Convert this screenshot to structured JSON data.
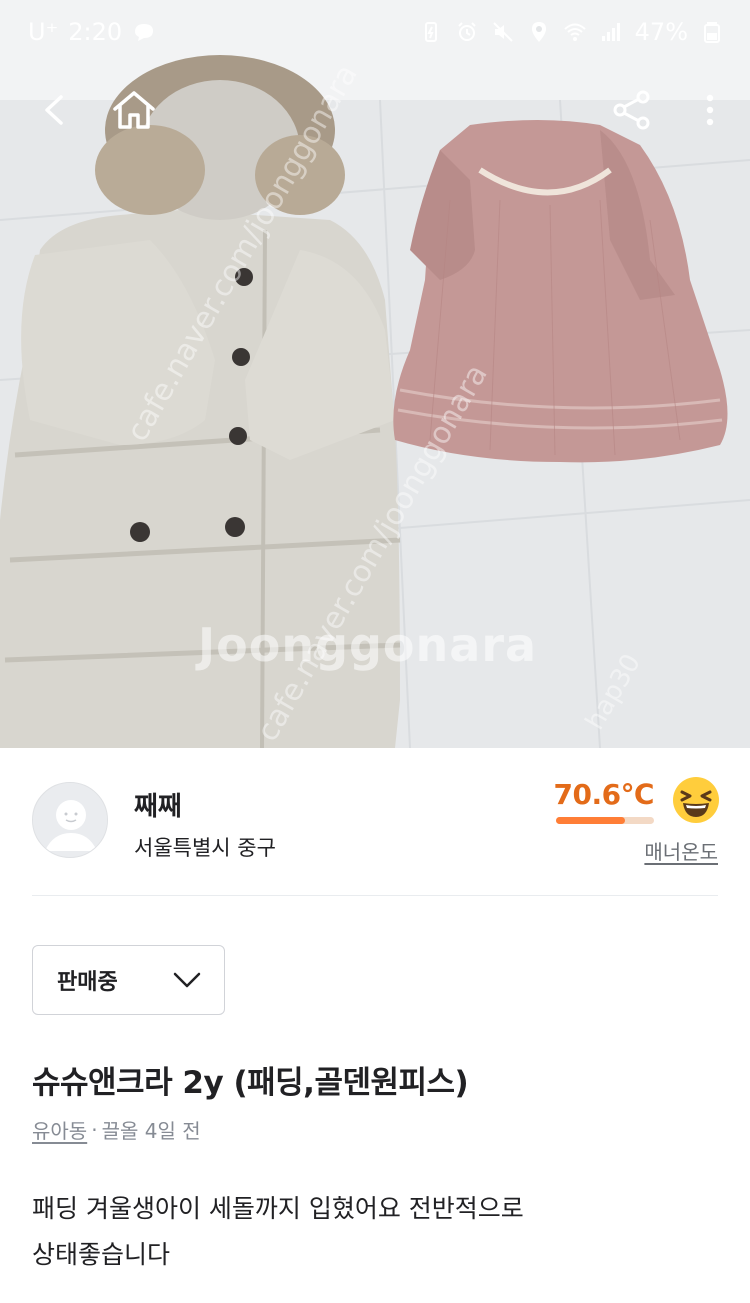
{
  "status_bar": {
    "carrier": "U⁺",
    "time": "2:20",
    "battery": "47%",
    "icons": [
      "chat-bubble-icon",
      "battery-saver-icon",
      "alarm-icon",
      "mute-icon",
      "location-icon",
      "wifi-icon",
      "signal-icon",
      "battery-icon"
    ]
  },
  "nav": {
    "icons": [
      "back-arrow-icon",
      "home-icon",
      "share-icon",
      "more-vertical-icon"
    ]
  },
  "photo": {
    "watermark": "Joonggonara",
    "watermark_url": "cafe.naver.com/joonggonara",
    "watermark_user": "hap30"
  },
  "seller": {
    "nickname": "째째",
    "region": "서울특별시 중구",
    "temperature": "70.6℃",
    "temperature_value": 70.6,
    "manner_label": "매너온도",
    "emoji": "laughing-face-icon",
    "accent_color": "#e36b19"
  },
  "post": {
    "sale_status": "판매중",
    "title": "슈슈앤크라 2y (패딩,골덴원피스)",
    "category": "유아동",
    "separator": "·",
    "bumped_time": "끌올 4일 전",
    "description_lines": [
      "패딩 겨울생아이 세돌까지 입혔어요 전반적으로",
      "상태좋습니다"
    ]
  }
}
